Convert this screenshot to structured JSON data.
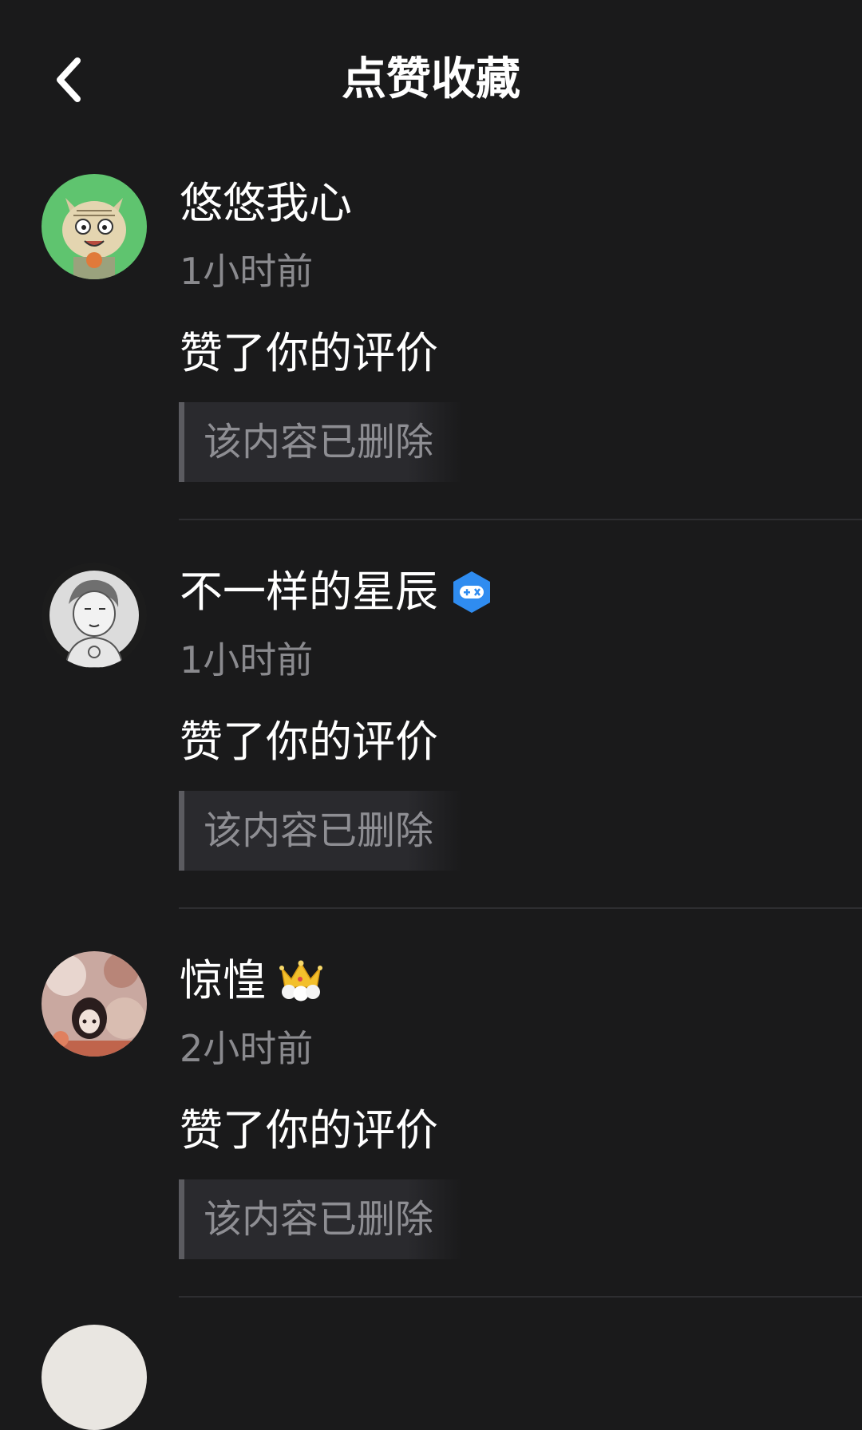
{
  "header": {
    "title": "点赞收藏",
    "back_icon": "chevron-left-icon"
  },
  "notifications": [
    {
      "user_name": "悠悠我心",
      "badge_icon": null,
      "time": "1小时前",
      "action": "赞了你的评价",
      "quote": "该内容已删除"
    },
    {
      "user_name": "不一样的星辰",
      "badge_icon": "gamepad-badge-icon",
      "badge_color": "#2f8cf0",
      "time": "1小时前",
      "action": "赞了你的评价",
      "quote": "该内容已删除"
    },
    {
      "user_name": "惊惶",
      "badge_icon": "crown-badge-icon",
      "badge_color": "#f3c02c",
      "time": "2小时前",
      "action": "赞了你的评价",
      "quote": "该内容已删除"
    }
  ],
  "colors": {
    "background": "#1a1a1b",
    "primary_text": "#ffffff",
    "secondary_text": "#8a8a8e",
    "quote_bg": "#2a2a2e",
    "quote_bar": "#5b5b60"
  }
}
